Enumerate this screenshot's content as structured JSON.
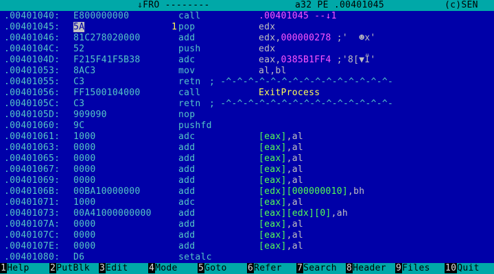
{
  "header": {
    "left": "⇓FRO --------",
    "mode": "a32 PE .00401045",
    "right": "(c)SEN"
  },
  "rows": [
    {
      "addr": ".00401040:",
      "bytes": "E800000000",
      "mnem": "call",
      "ops_parts": [
        {
          "t": ".00401045 --↓1",
          "c": "magenta"
        }
      ]
    },
    {
      "addr": ".00401045:",
      "bytes_cursor": "5A",
      "mark": "1",
      "mnem": "pop",
      "ops_parts": [
        {
          "t": "edx",
          "c": ""
        }
      ]
    },
    {
      "addr": ".00401046:",
      "bytes": "81C278020000",
      "mnem": "add",
      "ops_parts": [
        {
          "t": "edx,",
          "c": ""
        },
        {
          "t": "000000278",
          "c": "magenta"
        },
        {
          "t": " ;'  ☻x'",
          "c": ""
        }
      ]
    },
    {
      "addr": ".0040104C:",
      "bytes": "52",
      "mnem": "push",
      "ops_parts": [
        {
          "t": "edx",
          "c": ""
        }
      ]
    },
    {
      "addr": ".0040104D:",
      "bytes": "F215F41F5B38",
      "mnem": "adc",
      "ops_parts": [
        {
          "t": "eax,",
          "c": ""
        },
        {
          "t": "0385B1FF4",
          "c": "magenta"
        },
        {
          "t": " ;'8[▼Ï'",
          "c": ""
        }
      ]
    },
    {
      "addr": ".00401053:",
      "bytes": "8AC3",
      "mnem": "mov",
      "ops_parts": [
        {
          "t": "al,bl",
          "c": ""
        }
      ]
    },
    {
      "addr": ".00401055:",
      "bytes": "C3",
      "mnem": "retn",
      "mnem_color": "cyan",
      "ops_parts": [
        {
          "t": "; -^-^-^-^-^-^-^-^-^-^-^-^-^-^-^-",
          "c": "cyan"
        }
      ],
      "ops_left": "retn"
    },
    {
      "addr": ".00401056:",
      "bytes": "FF1500104000",
      "mnem": "call",
      "ops_parts": [
        {
          "t": "ExitProcess",
          "c": "yellow"
        }
      ]
    },
    {
      "addr": ".0040105C:",
      "bytes": "C3",
      "mnem": "retn",
      "ops_parts": [
        {
          "t": "; -^-^-^-^-^-^-^-^-^-^-^-^-^-^-^-",
          "c": "cyan"
        }
      ],
      "ops_left": "retn"
    },
    {
      "addr": ".0040105D:",
      "bytes": "909090",
      "mnem": "nop",
      "ops_parts": []
    },
    {
      "addr": ".00401060:",
      "bytes": "9C",
      "mnem": "pushfd",
      "ops_parts": []
    },
    {
      "addr": ".00401061:",
      "bytes": "1000",
      "mnem": "adc",
      "ops_parts": [
        {
          "t": "[eax]",
          "c": "green"
        },
        {
          "t": ",al",
          "c": ""
        }
      ]
    },
    {
      "addr": ".00401063:",
      "bytes": "0000",
      "mnem": "add",
      "ops_parts": [
        {
          "t": "[eax]",
          "c": "green"
        },
        {
          "t": ",al",
          "c": ""
        }
      ]
    },
    {
      "addr": ".00401065:",
      "bytes": "0000",
      "mnem": "add",
      "ops_parts": [
        {
          "t": "[eax]",
          "c": "green"
        },
        {
          "t": ",al",
          "c": ""
        }
      ]
    },
    {
      "addr": ".00401067:",
      "bytes": "0000",
      "mnem": "add",
      "ops_parts": [
        {
          "t": "[eax]",
          "c": "green"
        },
        {
          "t": ",al",
          "c": ""
        }
      ]
    },
    {
      "addr": ".00401069:",
      "bytes": "0000",
      "mnem": "add",
      "ops_parts": [
        {
          "t": "[eax]",
          "c": "green"
        },
        {
          "t": ",al",
          "c": ""
        }
      ]
    },
    {
      "addr": ".0040106B:",
      "bytes": "00BA10000000",
      "mnem": "add",
      "ops_parts": [
        {
          "t": "[edx][000000010]",
          "c": "green"
        },
        {
          "t": ",bh",
          "c": ""
        }
      ]
    },
    {
      "addr": ".00401071:",
      "bytes": "1000",
      "mnem": "adc",
      "ops_parts": [
        {
          "t": "[eax]",
          "c": "green"
        },
        {
          "t": ",al",
          "c": ""
        }
      ]
    },
    {
      "addr": ".00401073:",
      "bytes": "00A41000000000",
      "mnem": "add",
      "ops_parts": [
        {
          "t": "[eax][edx][0]",
          "c": "green"
        },
        {
          "t": ",ah",
          "c": ""
        }
      ]
    },
    {
      "addr": ".0040107A:",
      "bytes": "0000",
      "mnem": "add",
      "ops_parts": [
        {
          "t": "[eax]",
          "c": "green"
        },
        {
          "t": ",al",
          "c": ""
        }
      ]
    },
    {
      "addr": ".0040107C:",
      "bytes": "0000",
      "mnem": "add",
      "ops_parts": [
        {
          "t": "[eax]",
          "c": "green"
        },
        {
          "t": ",al",
          "c": ""
        }
      ]
    },
    {
      "addr": ".0040107E:",
      "bytes": "0000",
      "mnem": "add",
      "ops_parts": [
        {
          "t": "[eax]",
          "c": "green"
        },
        {
          "t": ",al",
          "c": ""
        }
      ]
    },
    {
      "addr": ".00401080:",
      "bytes": "D6",
      "mnem": "setalc",
      "ops_parts": []
    }
  ],
  "fkeys": [
    {
      "num": "1",
      "label": "Help"
    },
    {
      "num": "2",
      "label": "PutBlk"
    },
    {
      "num": "3",
      "label": "Edit"
    },
    {
      "num": "4",
      "label": "Mode"
    },
    {
      "num": "5",
      "label": "Goto"
    },
    {
      "num": "6",
      "label": "Refer"
    },
    {
      "num": "7",
      "label": "Search"
    },
    {
      "num": "8",
      "label": "Header"
    },
    {
      "num": "9",
      "label": "Files"
    },
    {
      "num": "10",
      "label": "Quit"
    }
  ],
  "colors": {
    "background": "#0000a8",
    "bar": "#00a8a8",
    "address": "#56c6c6",
    "text": "#c0c0c0",
    "memory_ref": "#55ff55",
    "immediate": "#ff55ff",
    "symbol": "#ffff55"
  }
}
